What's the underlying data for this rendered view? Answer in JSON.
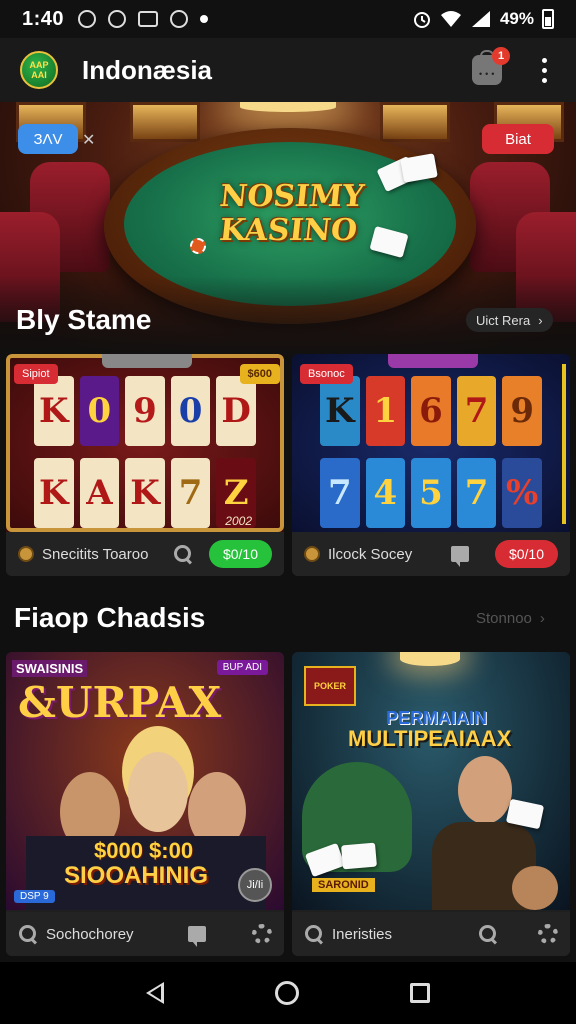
{
  "status_bar": {
    "time": "1:40",
    "battery": "49%"
  },
  "app_bar": {
    "logo_line1": "AAP",
    "logo_line2": "AAI",
    "title": "Indonæsia",
    "cart_badge": "1"
  },
  "hero": {
    "title_line1": "NOSIMY",
    "title_line2": "KASINO",
    "badge_left": "ЗΛV",
    "badge_left_close": "✕",
    "badge_right": "Biat"
  },
  "section1": {
    "title": "Bly Stame",
    "see_more": "Uict Rera",
    "see_more_arrow": "›",
    "cards": [
      {
        "tag_left": "Sipiot",
        "tag_right": "$600",
        "reels_top": [
          "K",
          "0",
          "9",
          "0",
          "D"
        ],
        "reels_bottom": [
          "K",
          "A",
          "K",
          "7",
          "Z"
        ],
        "mini_text": "2002",
        "footer_label": "Snecitits Toaroo",
        "button": "$0/10"
      },
      {
        "tag_left": "Bsonoc",
        "reels_top": [
          "K",
          "1",
          "6",
          "7",
          "9"
        ],
        "reels_bottom": [
          "7",
          "4",
          "5",
          "7",
          "%"
        ],
        "footer_label": "Ilcock Socey",
        "button": "$0/10"
      }
    ]
  },
  "section2": {
    "title": "Fiaop Chadsis",
    "see_more": "Stonnoo",
    "see_more_arrow": "›",
    "cards": [
      {
        "top_left": "SWAISINIS",
        "top_right": "BUP ADI",
        "headline": "&URPAX",
        "money": "$000 $:00",
        "subline": "SIOOAHINIG",
        "corner_tag": "DSP 9",
        "corner_btn": "Ji/Ii",
        "footer_label": "Sochochorey"
      },
      {
        "crest_text": "POKER",
        "headline1": "PERMAIAIN",
        "headline2": "MULTIPEAIAAX",
        "table_text": "SARONID",
        "footer_label": "Ineristies"
      }
    ]
  },
  "colors": {
    "accent_green": "#27c23b",
    "accent_red": "#d82c34",
    "accent_blue": "#3d8ee8",
    "gold": "#ffcf46"
  }
}
